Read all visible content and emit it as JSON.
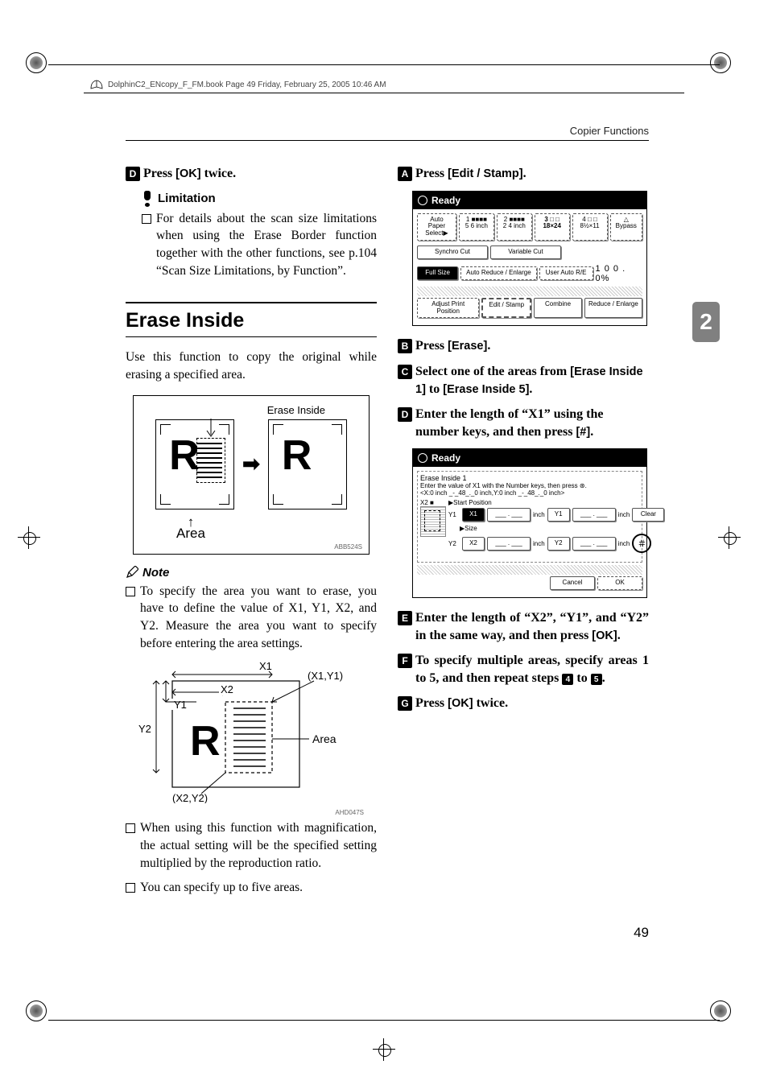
{
  "header_runner": "DolphinC2_ENcopy_F_FM.book  Page 49  Friday, February 25, 2005  10:46 AM",
  "running_head": "Copier Functions",
  "thumb_tab": "2",
  "page_number": "49",
  "left": {
    "step4": {
      "pre": "Press ",
      "btn": "[OK]",
      "post": " twice."
    },
    "limitation_title": "Limitation",
    "limitation_bullet": "For details about the scan size limitations when using the Erase Border function together with the other functions, see p.104 “Scan Size Limitations, by Function”.",
    "h2": "Erase Inside",
    "intro": "Use this function to copy the original while erasing a specified area.",
    "fig1_label": "Erase Inside",
    "fig1_area": "Area",
    "fig1_code": "ABB524S",
    "note_title": "Note",
    "note_bullet1": "To specify the area you want to erase, you have to define the value of X1, Y1, X2, and Y2. Measure the area you want to specify before entering the area settings.",
    "fig2": {
      "x1": "X1",
      "x2": "X2",
      "y1": "Y1",
      "y2": "Y2",
      "p1": "(X1,Y1)",
      "p2": "(X2,Y2)",
      "area": "Area",
      "code": "AHD047S"
    },
    "note_bullet2": "When using this function with magnification, the actual setting will be the specified setting multiplied by the reproduction ratio.",
    "note_bullet3": "You can specify up to five areas."
  },
  "right": {
    "step1": {
      "pre": "Press ",
      "btn": "[Edit / Stamp]",
      "post": "."
    },
    "ss1": {
      "ready": "Ready",
      "paper_label": "Auto Paper\nSelect▶",
      "tray1": "1 ■■■■\n5 6 inch",
      "tray2": "2 ■■■■\n2 4 inch",
      "tray3": "3 □ □\n18×24",
      "tray4": "4 □ □\n8½×11",
      "bypass": "△\nBypass",
      "synchro": "Synchro Cut",
      "variable": "Variable Cut",
      "fullsize": "Full Size",
      "autoreduce": "Auto Reduce / Enlarge",
      "userauto": "User Auto R/E",
      "pct": "1 0 0 . 0%",
      "adjust": "Adjust Print Position",
      "editstamp": "Edit / Stamp",
      "combine": "Combine",
      "reduce": "Reduce / Enlarge"
    },
    "step2": {
      "pre": "Press ",
      "btn": "[Erase]",
      "post": "."
    },
    "step3": {
      "pre": "Select one of the areas from ",
      "btn1": "[Erase Inside 1]",
      "mid": " to ",
      "btn2": "[Erase Inside 5]",
      "post": "."
    },
    "step4": {
      "pre": "Enter the length of “X1” using the number keys, and then press ",
      "btn": "[#]",
      "post": "."
    },
    "ss2": {
      "ready": "Ready",
      "title": "Erase Inside 1",
      "instr": "Enter the value of X1 with the Number keys, then press ⊛.",
      "range": "<X:0 inch _-_48_._0 inch,Y:0 inch _-_48_._0 inch>",
      "start": "▶Start Position",
      "size": "▶Size",
      "x1": "X1",
      "y1": "Y1",
      "x2": "X2",
      "y2": "Y2",
      "inch": "inch",
      "clear": "Clear",
      "hash": "＃",
      "cancel": "Cancel",
      "ok": "OK",
      "blank": "___ . ___",
      "x2lbl": "X2 ■"
    },
    "step5": {
      "pre": "Enter the length of “X2”, “Y1”, and “Y2” in the same way, and then press ",
      "btn": "[OK]",
      "post": "."
    },
    "step6a": "To specify multiple areas, specify areas 1 to 5, and then repeat steps ",
    "step6b": " to ",
    "step6c": ".",
    "step6_n1": "4",
    "step6_n2": "5",
    "step7": {
      "pre": "Press ",
      "btn": "[OK]",
      "post": " twice."
    }
  }
}
